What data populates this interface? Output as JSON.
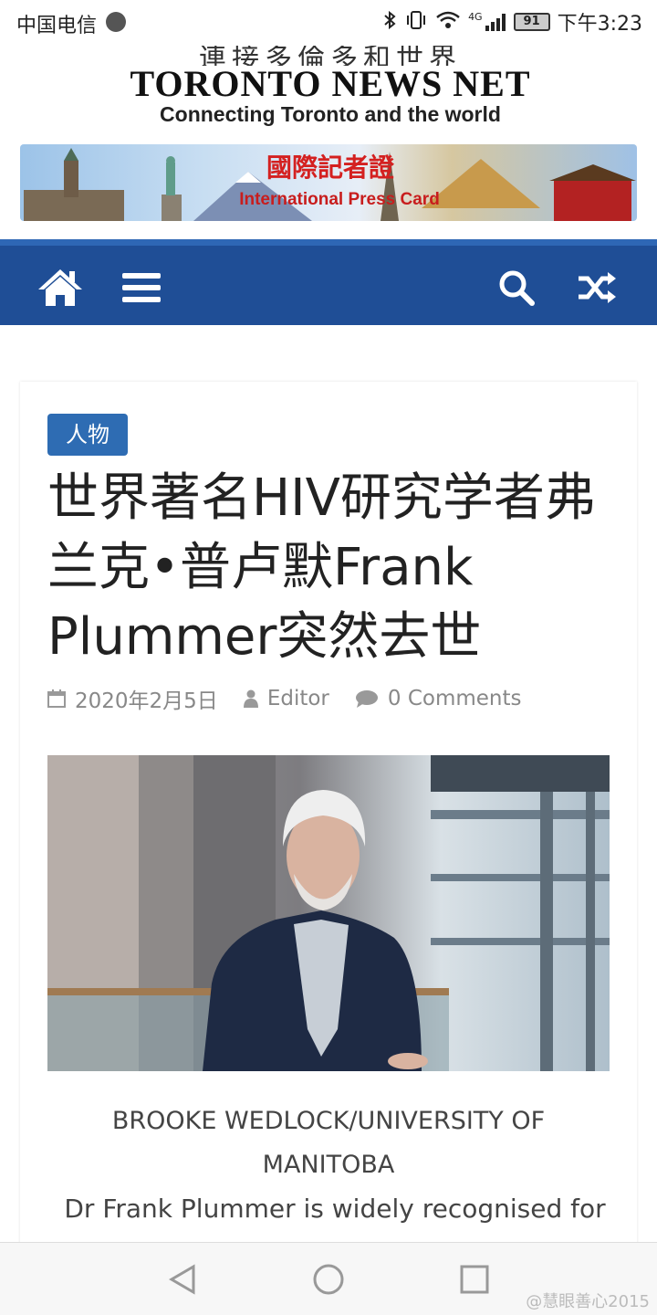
{
  "status_bar": {
    "carrier": "中国电信",
    "network": "4G",
    "battery": "91",
    "time": "下午3:23"
  },
  "header": {
    "logo_cn": "連接多倫多和世界",
    "logo_en": "TORONTO NEWS NET",
    "logo_tagline": "Connecting Toronto and the world",
    "banner_cn": "國際記者證",
    "banner_en": "International Press Card"
  },
  "nav": {
    "icons": [
      "home-icon",
      "menu-icon",
      "search-icon",
      "shuffle-icon"
    ]
  },
  "article": {
    "category": "人物",
    "title": "世界著名HIV研究学者弗兰克•普卢默Frank Plummer突然去世",
    "date": "2020年2月5日",
    "author": "Editor",
    "comments": "0 Comments",
    "caption": "BROOKE WEDLOCK/UNIVERSITY OF MANITOBA",
    "body_start": "Dr Frank Plummer is widely recognised for"
  },
  "system_nav": {
    "watermark": "@慧眼善心2015"
  },
  "colors": {
    "nav_bg": "#1f4e96",
    "accent": "#2e6cb3",
    "banner_red": "#c81d1d"
  }
}
